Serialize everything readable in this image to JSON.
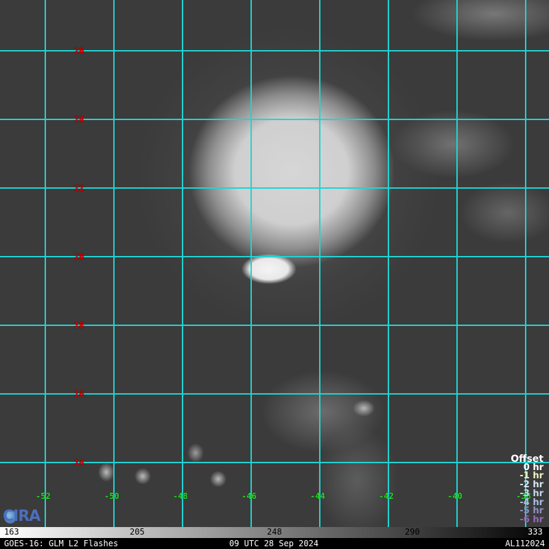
{
  "map": {
    "latitudes": [
      "26",
      "24",
      "22",
      "20",
      "18",
      "16",
      "14"
    ],
    "longitudes": [
      "-52",
      "-50",
      "-48",
      "-46",
      "-44",
      "-42",
      "-40",
      "-38"
    ],
    "grid_color": "#22d3d3"
  },
  "legend": {
    "title": "Offset",
    "items": [
      {
        "label": "0 hr",
        "color": "#ffffff"
      },
      {
        "label": "-1 hr",
        "color": "#f4f0c0"
      },
      {
        "label": "-2 hr",
        "color": "#d8e6f0"
      },
      {
        "label": "-3 hr",
        "color": "#c4d8ec"
      },
      {
        "label": "-4 hr",
        "color": "#a8c0e0"
      },
      {
        "label": "-5 hr",
        "color": "#9090c8"
      },
      {
        "label": "-6 hr",
        "color": "#9a6ab8"
      }
    ]
  },
  "logo": {
    "text": "CIRA"
  },
  "colorbar": {
    "ticks": [
      "163",
      "205",
      "248",
      "290",
      "333"
    ]
  },
  "footer": {
    "product": "GOES-16: GLM L2 Flashes",
    "time": "09 UTC 28 Sep 2024",
    "storm_id": "AL112024"
  }
}
